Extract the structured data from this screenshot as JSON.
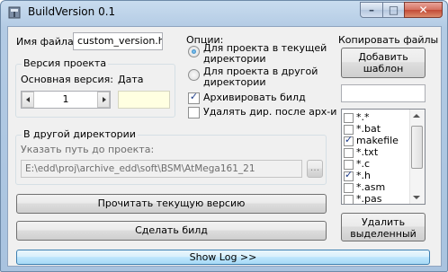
{
  "window": {
    "title": "BuildVersion 0.1",
    "icon": "hammer-icon",
    "controls": {
      "minimize": "–",
      "maximize": "□",
      "close": "✕"
    }
  },
  "file": {
    "label": "Имя файла:",
    "value": "custom_version.h"
  },
  "version": {
    "group_title": "Версия проекта",
    "main_label": "Основная версия:",
    "date_label": "Дата",
    "main_value": "1",
    "date_value": ""
  },
  "other_dir": {
    "group_title": "В другой директории",
    "hint": "Указать путь до проекта:",
    "path": "E:\\edd\\proj\\archive_edd\\soft\\BSM\\AtMega161_21",
    "browse": "..."
  },
  "options": {
    "title": "Опции:",
    "radios": [
      {
        "line1": "Для проекта в текущей",
        "line2": "директории",
        "checked": true
      },
      {
        "line1": "Для проекта в другой",
        "line2": "директории",
        "checked": false
      }
    ],
    "checks": [
      {
        "label": "Архивировать билд",
        "checked": true
      },
      {
        "label": "Удалять дир. после арх-и",
        "checked": false
      }
    ]
  },
  "copy_files": {
    "title": "Копировать файлы",
    "add_line1": "Добавить",
    "add_line2": "шаблон",
    "new_pattern": "",
    "items": [
      {
        "label": "*.*",
        "checked": false
      },
      {
        "label": "*.bat",
        "checked": false
      },
      {
        "label": "makefile",
        "checked": true
      },
      {
        "label": "*.txt",
        "checked": false
      },
      {
        "label": "*.c",
        "checked": false
      },
      {
        "label": "*.h",
        "checked": true
      },
      {
        "label": "*.asm",
        "checked": false
      },
      {
        "label": "*.pas",
        "checked": false
      }
    ],
    "delete_line1": "Удалить",
    "delete_line2": "выделенный"
  },
  "actions": {
    "read_version": "Прочитать текущую версию",
    "make_build": "Сделать билд",
    "show_log": "Show Log >>"
  },
  "colors": {
    "title_bar": "#b9cfe6",
    "close_button": "#c9503c",
    "date_field": "#ffffe1",
    "check_mark": "#1f3d8a"
  }
}
